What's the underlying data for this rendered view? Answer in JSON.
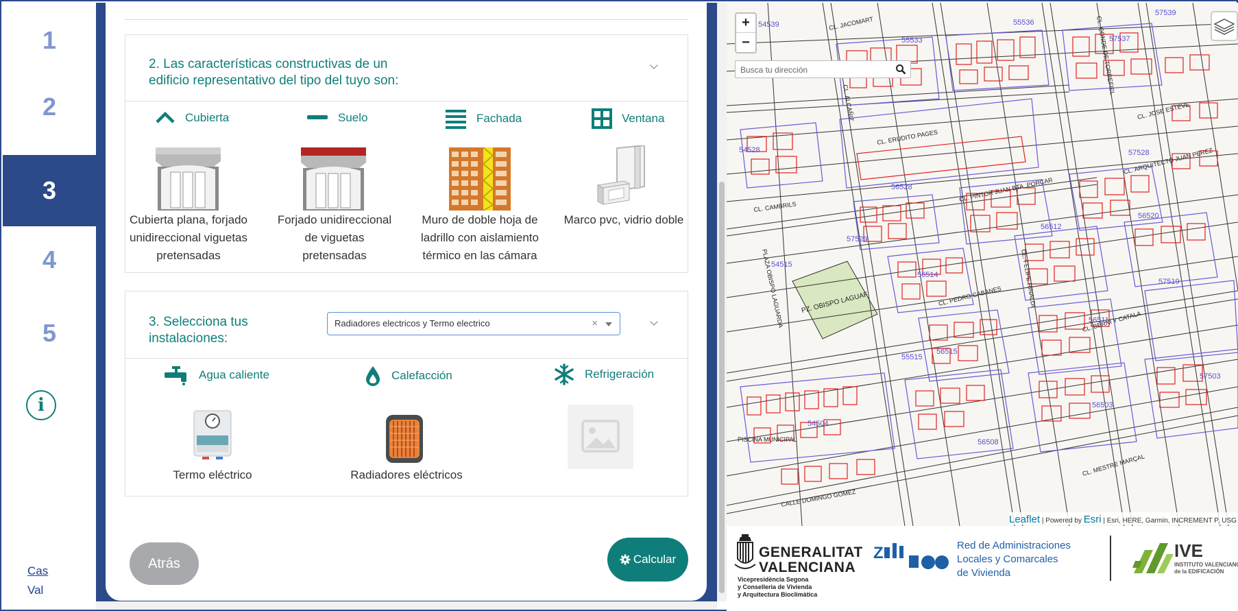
{
  "steps": [
    {
      "label": "1"
    },
    {
      "label": "2"
    },
    {
      "label": "3"
    },
    {
      "label": "4"
    },
    {
      "label": "5"
    }
  ],
  "info_label": "i",
  "languages": {
    "cas": "Cas",
    "val": "Val"
  },
  "section2": {
    "title_line1": "2. Las características constructivas de un",
    "title_line2": "edificio representativo del tipo del tuyo son:",
    "categories": [
      {
        "icon": "chevron-up-icon",
        "label": "Cubierta"
      },
      {
        "icon": "minus-icon",
        "label": "Suelo"
      },
      {
        "icon": "lines-icon",
        "label": "Fachada"
      },
      {
        "icon": "window-grid-icon",
        "label": "Ventana"
      }
    ],
    "items": [
      {
        "lines": [
          "Cubierta plana, forjado",
          "unidireccional viguetas",
          "pretensadas"
        ]
      },
      {
        "lines": [
          "Forjado unidireccional",
          "de viguetas",
          "pretensadas"
        ]
      },
      {
        "lines": [
          "Muro de doble hoja de",
          "ladrillo con aislamiento",
          "térmico en las cámara"
        ]
      },
      {
        "lines": [
          "Marco pvc, vidrio doble"
        ]
      }
    ]
  },
  "section3": {
    "title_line1": "3. Selecciona tus",
    "title_line2": "instalaciones:",
    "select_value": "Radiadores electricos y Termo electrico",
    "select_clear": "×",
    "categories": [
      {
        "icon": "faucet-icon",
        "label": "Agua caliente"
      },
      {
        "icon": "drop-icon",
        "label": "Calefacción"
      },
      {
        "icon": "snowflake-icon",
        "label": "Refrigeración"
      }
    ],
    "items": [
      {
        "label": "Termo eléctrico"
      },
      {
        "label": "Radiadores eléctricos"
      },
      {
        "label": ""
      }
    ]
  },
  "buttons": {
    "back": "Atrás",
    "calculate": "Calcular"
  },
  "map": {
    "zoom_in": "+",
    "zoom_out": "−",
    "search_placeholder": "Busca tu dirección",
    "attribution_leaflet": "Leaflet",
    "attribution_powered": "| Powered by",
    "attribution_esri": "Esri",
    "attribution_rest": "| Esri, HERE, Garmin, INCREMENT P, USG",
    "plaza_label": "PZ. OBISPO LAGUAF",
    "street_labels": [
      "CL. JACOMART",
      "CL. ERUDITO PAGES",
      "CL. PINTOR JUAN BTA. PORCAR",
      "CL. CAMBRILS",
      "CL. PEDRO CABANES",
      "CL. BERNI Y CATALA",
      "CL. MESTRE MARÇAL",
      "CALLE DOMINGO GOMEZ",
      "CL. ALCAÑIZ",
      "CL. FELIPE RINALDI",
      "CL. CONDE DE TORREFIEL",
      "PISCINA MUNICIPAL",
      "CL. ARQUITECTO JUAN PEREZ",
      "CL. JOSE ESTEVE",
      "PLAZA OBISPO LAGUARDA"
    ],
    "parcel_labels": [
      "54539",
      "55536",
      "55533",
      "57539",
      "57537",
      "54528",
      "56528",
      "57528",
      "56512",
      "56514",
      "54515",
      "56515",
      "57519",
      "56511",
      "55515",
      "54504",
      "56508",
      "56503",
      "57503",
      "56520",
      "57529"
    ]
  },
  "footer": {
    "gv_line1": "GENERALITAT",
    "gv_line2": "VALENCIANA",
    "gv_sub1": "Vicepresidència Segona",
    "gv_sub2": "y Conselleria de Vivienda",
    "gv_sub3": "y Arquitectura Bioclimàtica",
    "ral_line1": "Red de Administraciones",
    "ral_line2": "Locales y Comarcales",
    "ral_line3": "de Vivienda",
    "ive_title": "IVE",
    "ive_sub1": "INSTITUTO VALENCIANO",
    "ive_sub2": "de la EDIFICACIÓN"
  },
  "colors": {
    "rail_blue": "#2c4a8a",
    "teal": "#0f7e7a",
    "step_inactive": "#7f97cf",
    "parcel_red": "#e02020",
    "parcel_blue": "#6a5ad6",
    "park_green": "#d9e8c0"
  }
}
